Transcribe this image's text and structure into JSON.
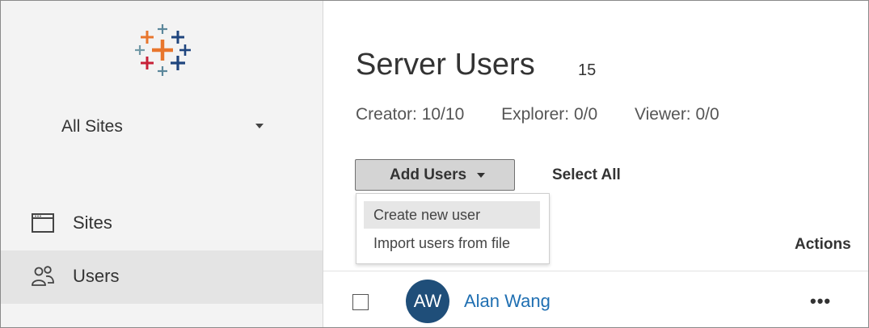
{
  "sidebar": {
    "site_selector": {
      "value": "All Sites",
      "icon": "chevron-down-icon"
    },
    "items": [
      {
        "label": "Sites",
        "icon": "sites-window-icon",
        "selected": false
      },
      {
        "label": "Users",
        "icon": "users-group-icon",
        "selected": true
      }
    ]
  },
  "main": {
    "title": "Server Users",
    "user_count": "15",
    "licenses": {
      "creator": "Creator: 10/10",
      "explorer": "Explorer: 0/0",
      "viewer": "Viewer: 0/0"
    },
    "toolbar": {
      "add_users_label": "Add Users",
      "select_all_label": "Select All"
    },
    "add_users_menu": {
      "items": [
        "Create new user",
        "Import users from file"
      ],
      "highlighted": "Create new user"
    },
    "table": {
      "columns": {
        "actions": "Actions"
      },
      "rows": [
        {
          "initials": "AW",
          "name": "Alan Wang",
          "actions": "•••"
        }
      ]
    }
  },
  "colors": {
    "sidebar_bg": "#f3f3f3",
    "sidebar_selected_bg": "#e4e4e4",
    "button_bg": "#d4d4d4",
    "avatar_bg": "#1f4e79",
    "link": "#1f6fb2",
    "logo_orange": "#e8762d",
    "logo_red": "#c72037",
    "logo_blue": "#1f457e",
    "logo_teal": "#5b879b",
    "logo_purple": "#7199a6"
  }
}
